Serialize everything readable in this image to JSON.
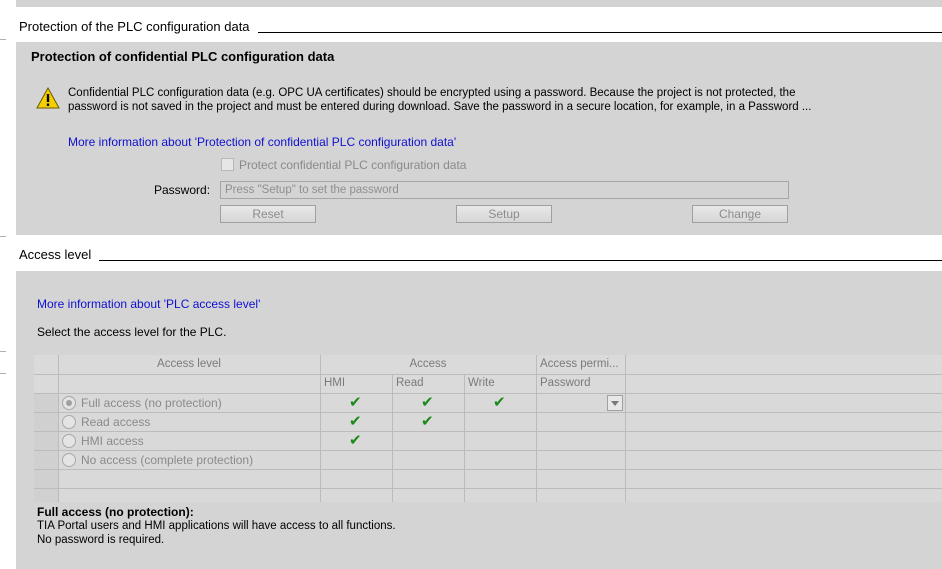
{
  "protection_section": {
    "header": "Protection of the PLC configuration data",
    "panel_title": "Protection of confidential PLC configuration data",
    "warning_line1": "Confidential PLC configuration data (e.g. OPC UA certificates) should be encrypted using a password. Because the project is not protected, the",
    "warning_line2": "password is not saved in the project and must be entered during download. Save the password in a secure location, for example, in a Password ...",
    "more_info_link": "More information about 'Protection of confidential PLC configuration data'",
    "checkbox_label": "Protect confidential PLC configuration data",
    "password_label": "Password:",
    "password_placeholder": "Press \"Setup\" to set the password",
    "reset_label": "Reset",
    "setup_label": "Setup",
    "change_label": "Change"
  },
  "access_section": {
    "header": "Access level",
    "more_info_link": "More information about 'PLC access level'",
    "instruction": "Select the access level for the PLC.",
    "table": {
      "col_access_level": "Access level",
      "col_access": "Access",
      "col_access_permission": "Access permi...",
      "sub_hmi": "HMI",
      "sub_read": "Read",
      "sub_write": "Write",
      "sub_password": "Password",
      "rows": [
        {
          "label": "Full access (no protection)",
          "hmi": true,
          "read": true,
          "write": true,
          "selected": true
        },
        {
          "label": "Read access",
          "hmi": true,
          "read": true,
          "write": false,
          "selected": false
        },
        {
          "label": "HMI access",
          "hmi": true,
          "read": false,
          "write": false,
          "selected": false
        },
        {
          "label": "No access (complete protection)",
          "hmi": false,
          "read": false,
          "write": false,
          "selected": false
        }
      ]
    },
    "description_title": "Full access (no protection):",
    "description_line1": "TIA Portal users and HMI applications will have access to all functions.",
    "description_line2": "No password is required."
  },
  "icons": {
    "warning": "warning-icon",
    "check": "check-icon",
    "dropdown": "chevron-down-icon"
  },
  "colors": {
    "panel_bg": "#d4d4d4",
    "link": "#1010d0",
    "check": "#1a8a1a",
    "warning_yellow": "#f5d000"
  }
}
